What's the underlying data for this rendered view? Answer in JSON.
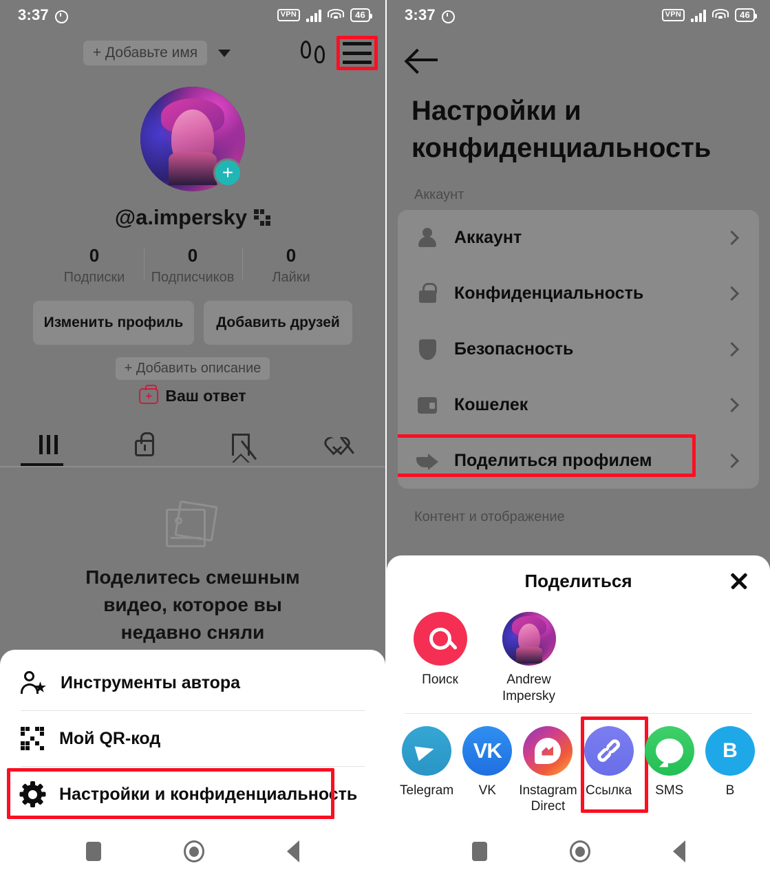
{
  "status_bar": {
    "time": "3:37",
    "alarm_icon": "alarm-icon",
    "vpn_label": "VPN",
    "battery_level": "46"
  },
  "left_panel": {
    "topbar": {
      "add_name_label": "+ Добавьте имя",
      "dropdown_icon": "chevron-down-icon",
      "footprints_icon": "footprints-icon",
      "menu_icon": "hamburger-menu-icon"
    },
    "profile": {
      "avatar_icon": "profile-avatar",
      "add_story_label": "+",
      "handle": "@a.impersky",
      "qr_icon": "qr-code-icon",
      "stats": [
        {
          "value": "0",
          "label": "Подписки"
        },
        {
          "value": "0",
          "label": "Подписчиков"
        },
        {
          "value": "0",
          "label": "Лайки"
        }
      ],
      "edit_profile_label": "Изменить профиль",
      "add_friends_label": "Добавить друзей",
      "add_bio_label": "+ Добавить описание",
      "your_answer_label": "Ваш ответ"
    },
    "tabs": [
      {
        "name": "posts-tab",
        "icon": "grid-icon",
        "active": true
      },
      {
        "name": "private-tab",
        "icon": "lock-icon",
        "active": false
      },
      {
        "name": "saved-tab",
        "icon": "bookmark-hidden-icon",
        "active": false
      },
      {
        "name": "liked-tab",
        "icon": "heart-hidden-icon",
        "active": false
      }
    ],
    "empty_state": {
      "icon": "photos-placeholder-icon",
      "line1": "Поделитесь смешным",
      "line2": "видео, которое вы",
      "line3": "недавно сняли"
    },
    "sheet": {
      "items": [
        {
          "label": "Инструменты автора",
          "icon": "person-star-icon",
          "highlighted": false
        },
        {
          "label": "Мой QR-код",
          "icon": "qr-code-icon",
          "highlighted": false
        },
        {
          "label": "Настройки и конфиденциальность",
          "icon": "gear-icon",
          "highlighted": true
        }
      ]
    }
  },
  "right_panel": {
    "back_icon": "back-arrow-icon",
    "title_line1": "Настройки и",
    "title_line2": "конфиденциальность",
    "section_account_label": "Аккаунт",
    "settings_items": [
      {
        "label": "Аккаунт",
        "icon": "person-icon",
        "highlighted": false
      },
      {
        "label": "Конфиденциальность",
        "icon": "lock-icon",
        "highlighted": false
      },
      {
        "label": "Безопасность",
        "icon": "shield-icon",
        "highlighted": false
      },
      {
        "label": "Кошелек",
        "icon": "wallet-icon",
        "highlighted": false
      },
      {
        "label": "Поделиться профилем",
        "icon": "share-arrow-icon",
        "highlighted": true
      }
    ],
    "section_content_label": "Контент и отображение",
    "share_sheet": {
      "title": "Поделиться",
      "close_icon": "close-icon",
      "contacts": [
        {
          "label": "Поиск",
          "icon": "search-icon",
          "type": "search"
        },
        {
          "label": "Andrew Impersky",
          "icon": "contact-avatar",
          "type": "contact"
        }
      ],
      "apps": [
        {
          "label": "Telegram",
          "icon": "telegram-icon",
          "highlighted": false
        },
        {
          "label": "VK",
          "icon": "vk-icon",
          "highlighted": false
        },
        {
          "label": "Instagram Direct",
          "icon": "instagram-direct-icon",
          "highlighted": false
        },
        {
          "label": "Ссылка",
          "icon": "link-icon",
          "highlighted": true
        },
        {
          "label": "SMS",
          "icon": "sms-icon",
          "highlighted": false
        },
        {
          "label": "B",
          "icon": "more-app-icon",
          "highlighted": false
        }
      ]
    }
  },
  "navbar": {
    "recents_icon": "recents-square-icon",
    "home_icon": "home-circle-icon",
    "back_icon": "back-triangle-icon"
  },
  "colors": {
    "accent_pink": "#f42f53",
    "highlight_red": "#fa0f23",
    "teal_badge": "#20b6b6",
    "link_purple": "#7b7ef0"
  }
}
